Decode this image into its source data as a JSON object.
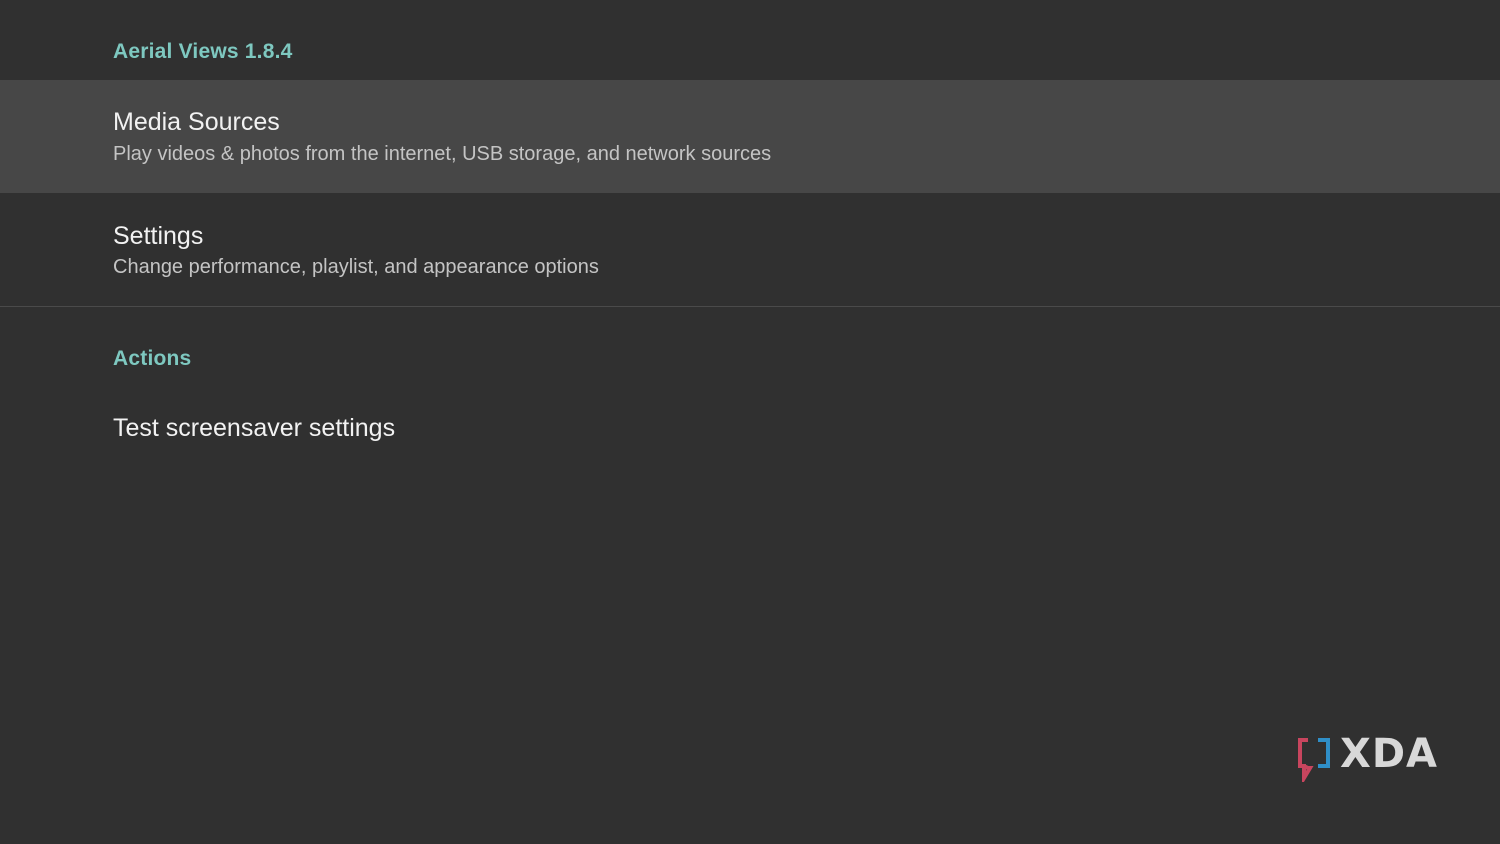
{
  "app": {
    "header": "Aerial Views 1.8.4"
  },
  "preferences": [
    {
      "title": "Media Sources",
      "summary": "Play videos & photos from the internet, USB storage, and network sources",
      "focused": true
    },
    {
      "title": "Settings",
      "summary": "Change performance, playlist, and appearance options",
      "focused": false
    }
  ],
  "actions": {
    "header": "Actions",
    "items": [
      {
        "title": "Test screensaver settings"
      }
    ]
  },
  "watermark": {
    "logo_text": "XDA",
    "icon": "xda-bracket-logo-icon"
  },
  "colors": {
    "background": "#303030",
    "focused_row": "#474747",
    "accent": "#7ec8c0",
    "title_text": "#f2f2f2",
    "summary_text": "#c4c4c4"
  }
}
